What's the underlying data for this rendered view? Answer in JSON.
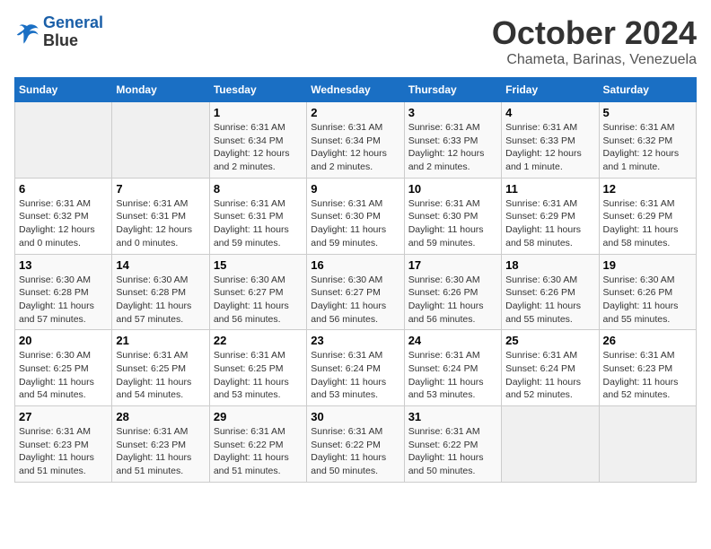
{
  "logo": {
    "line1": "General",
    "line2": "Blue"
  },
  "title": "October 2024",
  "location": "Chameta, Barinas, Venezuela",
  "days_header": [
    "Sunday",
    "Monday",
    "Tuesday",
    "Wednesday",
    "Thursday",
    "Friday",
    "Saturday"
  ],
  "weeks": [
    [
      {
        "day": "",
        "content": ""
      },
      {
        "day": "",
        "content": ""
      },
      {
        "day": "1",
        "content": "Sunrise: 6:31 AM\nSunset: 6:34 PM\nDaylight: 12 hours and 2 minutes."
      },
      {
        "day": "2",
        "content": "Sunrise: 6:31 AM\nSunset: 6:34 PM\nDaylight: 12 hours and 2 minutes."
      },
      {
        "day": "3",
        "content": "Sunrise: 6:31 AM\nSunset: 6:33 PM\nDaylight: 12 hours and 2 minutes."
      },
      {
        "day": "4",
        "content": "Sunrise: 6:31 AM\nSunset: 6:33 PM\nDaylight: 12 hours and 1 minute."
      },
      {
        "day": "5",
        "content": "Sunrise: 6:31 AM\nSunset: 6:32 PM\nDaylight: 12 hours and 1 minute."
      }
    ],
    [
      {
        "day": "6",
        "content": "Sunrise: 6:31 AM\nSunset: 6:32 PM\nDaylight: 12 hours and 0 minutes."
      },
      {
        "day": "7",
        "content": "Sunrise: 6:31 AM\nSunset: 6:31 PM\nDaylight: 12 hours and 0 minutes."
      },
      {
        "day": "8",
        "content": "Sunrise: 6:31 AM\nSunset: 6:31 PM\nDaylight: 11 hours and 59 minutes."
      },
      {
        "day": "9",
        "content": "Sunrise: 6:31 AM\nSunset: 6:30 PM\nDaylight: 11 hours and 59 minutes."
      },
      {
        "day": "10",
        "content": "Sunrise: 6:31 AM\nSunset: 6:30 PM\nDaylight: 11 hours and 59 minutes."
      },
      {
        "day": "11",
        "content": "Sunrise: 6:31 AM\nSunset: 6:29 PM\nDaylight: 11 hours and 58 minutes."
      },
      {
        "day": "12",
        "content": "Sunrise: 6:31 AM\nSunset: 6:29 PM\nDaylight: 11 hours and 58 minutes."
      }
    ],
    [
      {
        "day": "13",
        "content": "Sunrise: 6:30 AM\nSunset: 6:28 PM\nDaylight: 11 hours and 57 minutes."
      },
      {
        "day": "14",
        "content": "Sunrise: 6:30 AM\nSunset: 6:28 PM\nDaylight: 11 hours and 57 minutes."
      },
      {
        "day": "15",
        "content": "Sunrise: 6:30 AM\nSunset: 6:27 PM\nDaylight: 11 hours and 56 minutes."
      },
      {
        "day": "16",
        "content": "Sunrise: 6:30 AM\nSunset: 6:27 PM\nDaylight: 11 hours and 56 minutes."
      },
      {
        "day": "17",
        "content": "Sunrise: 6:30 AM\nSunset: 6:26 PM\nDaylight: 11 hours and 56 minutes."
      },
      {
        "day": "18",
        "content": "Sunrise: 6:30 AM\nSunset: 6:26 PM\nDaylight: 11 hours and 55 minutes."
      },
      {
        "day": "19",
        "content": "Sunrise: 6:30 AM\nSunset: 6:26 PM\nDaylight: 11 hours and 55 minutes."
      }
    ],
    [
      {
        "day": "20",
        "content": "Sunrise: 6:30 AM\nSunset: 6:25 PM\nDaylight: 11 hours and 54 minutes."
      },
      {
        "day": "21",
        "content": "Sunrise: 6:31 AM\nSunset: 6:25 PM\nDaylight: 11 hours and 54 minutes."
      },
      {
        "day": "22",
        "content": "Sunrise: 6:31 AM\nSunset: 6:25 PM\nDaylight: 11 hours and 53 minutes."
      },
      {
        "day": "23",
        "content": "Sunrise: 6:31 AM\nSunset: 6:24 PM\nDaylight: 11 hours and 53 minutes."
      },
      {
        "day": "24",
        "content": "Sunrise: 6:31 AM\nSunset: 6:24 PM\nDaylight: 11 hours and 53 minutes."
      },
      {
        "day": "25",
        "content": "Sunrise: 6:31 AM\nSunset: 6:24 PM\nDaylight: 11 hours and 52 minutes."
      },
      {
        "day": "26",
        "content": "Sunrise: 6:31 AM\nSunset: 6:23 PM\nDaylight: 11 hours and 52 minutes."
      }
    ],
    [
      {
        "day": "27",
        "content": "Sunrise: 6:31 AM\nSunset: 6:23 PM\nDaylight: 11 hours and 51 minutes."
      },
      {
        "day": "28",
        "content": "Sunrise: 6:31 AM\nSunset: 6:23 PM\nDaylight: 11 hours and 51 minutes."
      },
      {
        "day": "29",
        "content": "Sunrise: 6:31 AM\nSunset: 6:22 PM\nDaylight: 11 hours and 51 minutes."
      },
      {
        "day": "30",
        "content": "Sunrise: 6:31 AM\nSunset: 6:22 PM\nDaylight: 11 hours and 50 minutes."
      },
      {
        "day": "31",
        "content": "Sunrise: 6:31 AM\nSunset: 6:22 PM\nDaylight: 11 hours and 50 minutes."
      },
      {
        "day": "",
        "content": ""
      },
      {
        "day": "",
        "content": ""
      }
    ]
  ]
}
